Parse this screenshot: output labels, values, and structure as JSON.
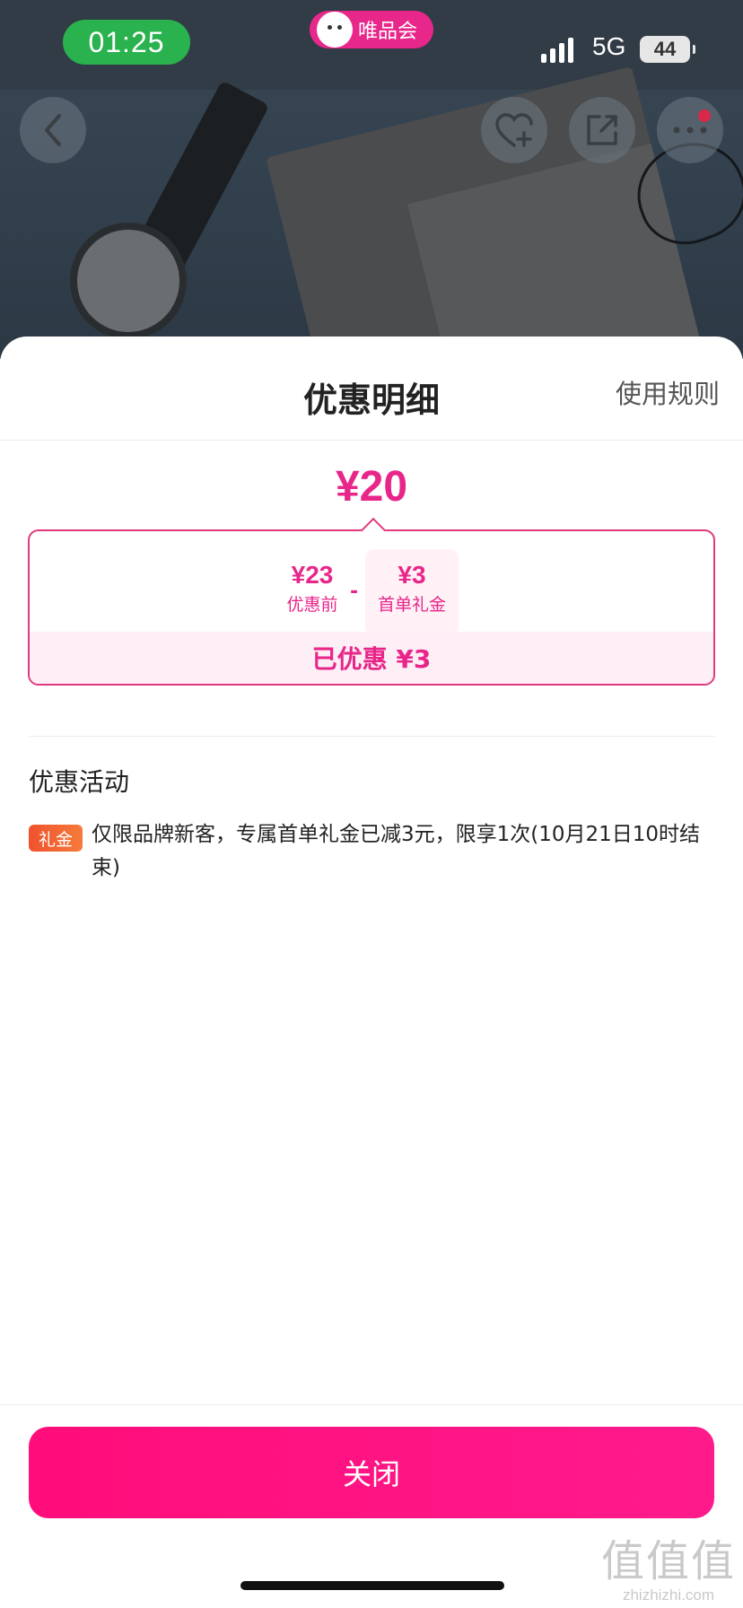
{
  "status_bar": {
    "time": "01:25",
    "network": "5G",
    "battery": "44"
  },
  "app_badge": {
    "name": "唯品会"
  },
  "nav": {
    "icons": [
      "back-icon",
      "favorite-add-icon",
      "share-icon",
      "more-icon"
    ]
  },
  "sheet": {
    "title": "优惠明细",
    "rules_link": "使用规则",
    "final_price": "¥20",
    "breakdown": {
      "original_amount": "¥23",
      "original_label": "优惠前",
      "operator": "-",
      "discount_amount": "¥3",
      "discount_label": "首单礼金",
      "saved_text": "已优惠 ¥3"
    },
    "activity_section_title": "优惠活动",
    "activity": {
      "tag": "礼金",
      "text": "仅限品牌新客，专属首单礼金已减3元，限享1次(10月21日10时结束)"
    },
    "close_button": "关闭"
  },
  "watermark": {
    "line1": "值值值",
    "line2": "zhizhizhi.com"
  },
  "colors": {
    "accent": "#e8268a",
    "button": "#ff0d7a",
    "tag": "#f0522e",
    "status_time_bg": "#2ab24e"
  }
}
